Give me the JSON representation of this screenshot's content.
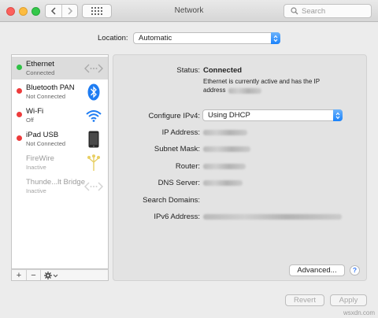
{
  "window": {
    "title": "Network",
    "search_placeholder": "Search"
  },
  "location": {
    "label": "Location:",
    "value": "Automatic"
  },
  "services": [
    {
      "name": "Ethernet",
      "status": "Connected",
      "dot": "#2fc145",
      "icon": "ethernet-icon",
      "dim": false,
      "selected": true
    },
    {
      "name": "Bluetooth PAN",
      "status": "Not Connected",
      "dot": "#ed3b3b",
      "icon": "bluetooth-icon",
      "dim": false,
      "selected": false
    },
    {
      "name": "Wi-Fi",
      "status": "Off",
      "dot": "#ed3b3b",
      "icon": "wifi-icon",
      "dim": false,
      "selected": false
    },
    {
      "name": "iPad USB",
      "status": "Not Connected",
      "dot": "#ed3b3b",
      "icon": "ipad-icon",
      "dim": false,
      "selected": false
    },
    {
      "name": "FireWire",
      "status": "Inactive",
      "dot": null,
      "icon": "firewire-icon",
      "dim": true,
      "selected": false
    },
    {
      "name": "Thunde...lt Bridge",
      "status": "Inactive",
      "dot": null,
      "icon": "thunderbolt-bridge-icon",
      "dim": true,
      "selected": false
    }
  ],
  "details": {
    "status_label": "Status:",
    "status_value": "Connected",
    "status_desc_line1": "Ethernet is currently active and has the IP",
    "status_desc_line2": "address",
    "configure_label": "Configure IPv4:",
    "configure_value": "Using DHCP",
    "ip_label": "IP Address:",
    "subnet_label": "Subnet Mask:",
    "router_label": "Router:",
    "dns_label": "DNS Server:",
    "search_domains_label": "Search Domains:",
    "ipv6_label": "IPv6 Address:"
  },
  "buttons": {
    "advanced": "Advanced...",
    "help": "?",
    "revert": "Revert",
    "apply": "Apply"
  },
  "watermark": "wsxdn.com",
  "colors": {
    "accent": "#1a82fb",
    "connected": "#2fc145",
    "disconnected": "#ed3b3b"
  }
}
